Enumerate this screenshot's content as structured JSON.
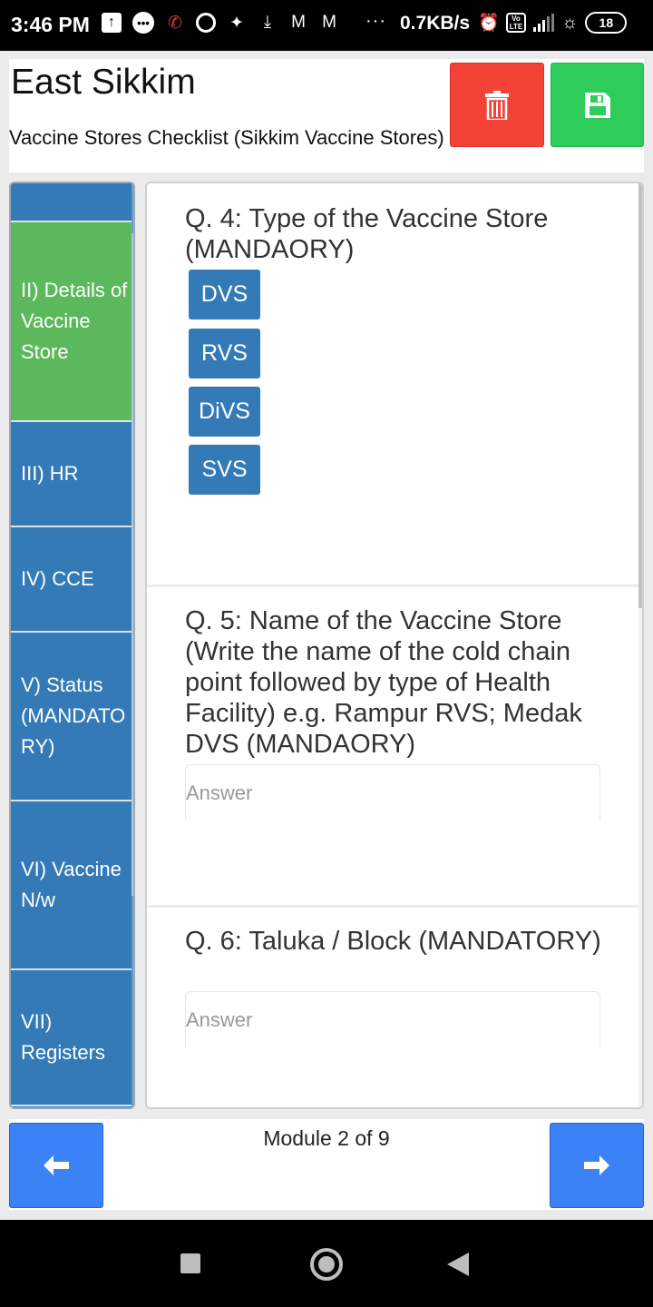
{
  "status_bar": {
    "time": "3:46 PM",
    "dots": "···",
    "network_speed": "0.7KB/s",
    "volte_label": "Vo\nLTE",
    "battery": "18"
  },
  "header": {
    "title": "East Sikkim",
    "subtitle": "Vaccine Stores Checklist (Sikkim Vaccine Stores)",
    "delete_icon": "trash-icon",
    "save_icon": "floppy-disk-icon",
    "delete_color": "#f44336",
    "save_color": "#2ecc5b"
  },
  "sidebar": {
    "items": [
      {
        "label": ""
      },
      {
        "label": "II) Details of Vaccine Store",
        "active": true
      },
      {
        "label": "III) HR"
      },
      {
        "label": "IV) CCE"
      },
      {
        "label": "V) Status (MANDATORY)"
      },
      {
        "label": "VI) Vaccine N/w"
      },
      {
        "label": "VII) Registers"
      }
    ],
    "active_color": "#5cb85c",
    "item_color": "#337ab7"
  },
  "questions": [
    {
      "text": "Q. 4: Type of the Vaccine Store (MANDAORY)",
      "options": [
        "DVS",
        "RVS",
        "DiVS",
        "SVS"
      ]
    },
    {
      "text": "Q. 5: Name of the Vaccine Store (Write the name of the cold chain point followed by type of Health Facility) e.g. Rampur RVS; Medak DVS (MANDAORY)",
      "answer_value": "",
      "answer_placeholder": "Answer"
    },
    {
      "text": "Q. 6: Taluka / Block (MANDATORY)",
      "answer_value": "",
      "answer_placeholder": "Answer"
    }
  ],
  "footer": {
    "module_text": "Module 2 of 9",
    "prev_icon": "arrow-left-icon",
    "next_icon": "arrow-right-icon",
    "nav_color": "#3b82f6"
  },
  "system_nav": {
    "recents_icon": "square-icon",
    "home_icon": "circle-icon",
    "back_icon": "triangle-back-icon"
  }
}
